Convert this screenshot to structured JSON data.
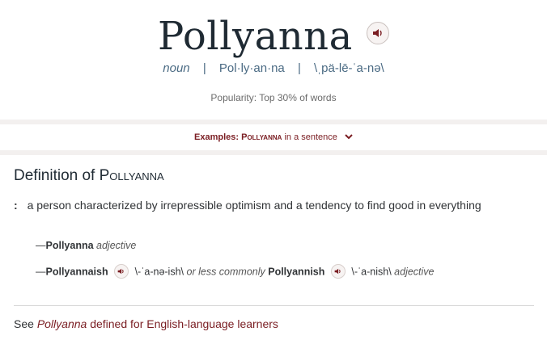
{
  "entry": {
    "headword": "Pollyanna",
    "part_of_speech": "noun",
    "syllables": "Pol·ly·an·na",
    "pronunciation": "\\ˌpä-lē-ˈa-nə\\",
    "popularity": "Popularity: Top 30% of words"
  },
  "examples_bar": {
    "label": "Examples:",
    "word": "Pollyanna",
    "suffix": " in a sentence"
  },
  "definition": {
    "title_prefix": "Definition of ",
    "title_word": "Pollyanna",
    "colon": ":",
    "text": "a person characterized by irrepressible optimism and a tendency to find good in everything"
  },
  "run_ons": [
    {
      "dash": "—",
      "word": "Pollyanna",
      "fl": "adjective"
    },
    {
      "dash": "—",
      "word": "Pollyannaish",
      "pron": "\\-ˈa-nə-ish\\",
      "connector": "or less commonly",
      "alt_word": "Pollyannish",
      "alt_pron": "\\-ˈa-nish\\",
      "fl": "adjective"
    }
  ],
  "see_also": {
    "prefix": "See ",
    "word": "Pollyanna",
    "suffix": " defined for English-language learners"
  },
  "colors": {
    "accent": "#7a1d22",
    "heading": "#1f2a33",
    "pron_blue": "#4a6a83"
  }
}
